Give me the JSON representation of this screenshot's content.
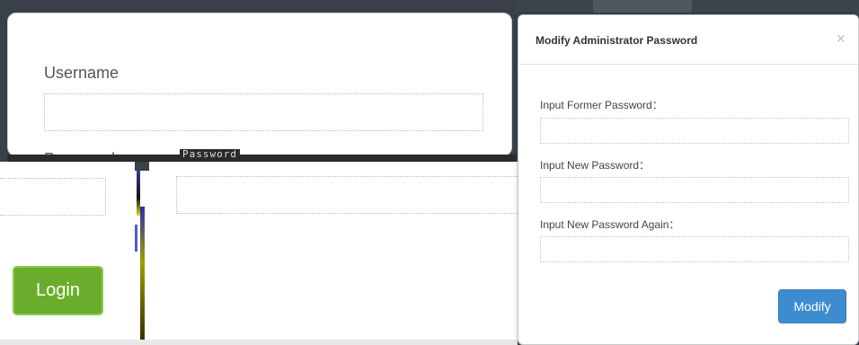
{
  "login": {
    "username_label": "Username",
    "password_label": "Password",
    "glitch_text": "Password",
    "login_button": "Login"
  },
  "modal": {
    "title": "Modify Administrator Password",
    "close": "×",
    "fields": [
      {
        "label": "Input Former Password：",
        "value": ""
      },
      {
        "label": "Input New Password：",
        "value": ""
      },
      {
        "label": "Input New Password Again：",
        "value": ""
      }
    ],
    "modify_button": "Modify"
  },
  "colors": {
    "login_button": "#6aac2b",
    "modify_button": "#3e8cd0",
    "backdrop": "#3a4048"
  }
}
